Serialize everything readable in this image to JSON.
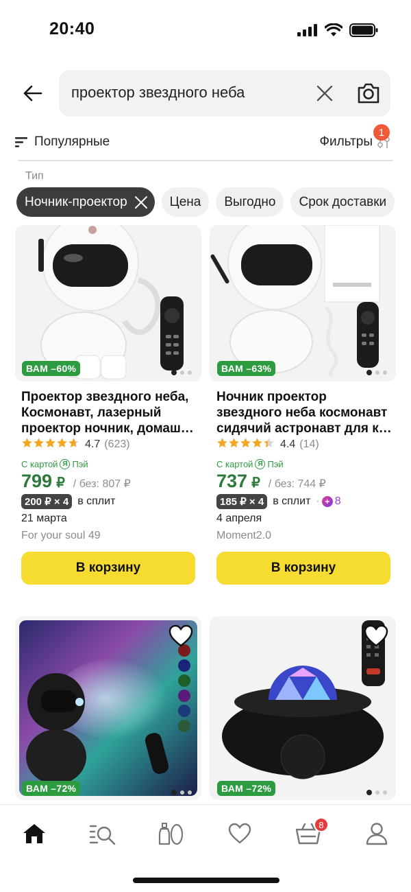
{
  "status_bar": {
    "time": "20:40"
  },
  "search": {
    "query": "проектор звездного неба"
  },
  "sort": {
    "label": "Популярные"
  },
  "filters": {
    "label": "Фильтры",
    "count": "1"
  },
  "type_label": "Тип",
  "chips": [
    {
      "label": "Ночник-проектор",
      "active": true
    },
    {
      "label": "Цена"
    },
    {
      "label": "Выгодно"
    },
    {
      "label": "Срок доставки"
    }
  ],
  "products": [
    {
      "discount": "ВАМ –60%",
      "title_lines": [
        "Проектор звездного неба,",
        "Космонавт, лазерный",
        "проектор ночник, домаш…"
      ],
      "rating": "4.7",
      "reviews": "(623)",
      "stars": 4.7,
      "pay_label": "С картой",
      "pay_brand": "Пэй",
      "price": "799",
      "currency": "₽",
      "old_price": "/ без: 807 ₽",
      "split_tag": "200 ₽ × 4",
      "split_label": "в сплит",
      "delivery": "21 марта",
      "seller": "For your soul 49",
      "cart": "В корзину"
    },
    {
      "discount": "ВАМ –63%",
      "title_lines": [
        "Ночник проектор",
        "звездного неба космонавт",
        "сидячий астронавт для к…"
      ],
      "rating": "4.4",
      "reviews": "(14)",
      "stars": 4.4,
      "pay_label": "С картой",
      "pay_brand": "Пэй",
      "price": "737",
      "currency": "₽",
      "old_price": "/ без: 744 ₽",
      "split_tag": "185 ₽ × 4",
      "split_label": "в сплит",
      "plus_points": "8",
      "delivery": "4 апреля",
      "seller": "Moment2.0",
      "cart": "В корзину"
    },
    {
      "discount": "ВАМ –72%"
    },
    {
      "discount": "ВАМ –72%"
    }
  ],
  "bottom_nav": {
    "cart_count": "8"
  },
  "colors": {
    "accent_yellow": "#f6db30",
    "price_green": "#2d7a3a",
    "discount_green": "#2d9b40",
    "badge_red": "#e23c3c"
  }
}
